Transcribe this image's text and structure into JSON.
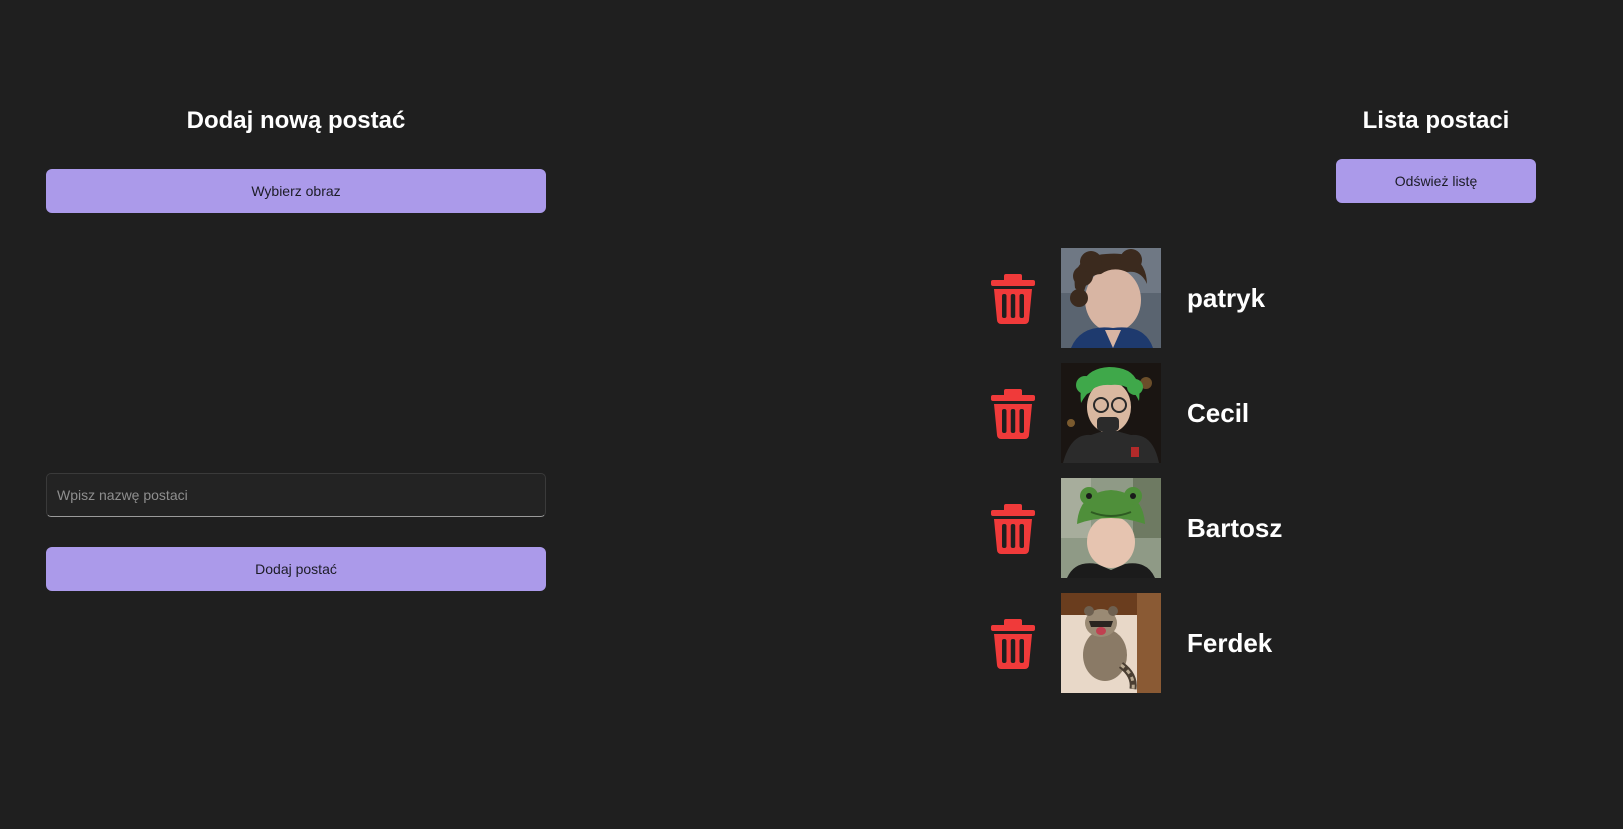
{
  "add_panel": {
    "title": "Dodaj nową postać",
    "choose_image_label": "Wybierz obraz",
    "name_input": {
      "value": "",
      "placeholder": "Wpisz nazwę postaci"
    },
    "add_button_label": "Dodaj postać"
  },
  "list_panel": {
    "title": "Lista postaci",
    "refresh_label": "Odśwież listę",
    "delete_icon": "trash-icon",
    "characters": [
      {
        "name": "patryk",
        "avatar": "photo-curly-hair-person"
      },
      {
        "name": "Cecil",
        "avatar": "photo-green-hair-person"
      },
      {
        "name": "Bartosz",
        "avatar": "photo-frog-hat-person"
      },
      {
        "name": "Ferdek",
        "avatar": "photo-raccoon"
      }
    ]
  },
  "colors": {
    "background": "#1f1f1f",
    "button": "#ab9aea",
    "button_text": "#1c1c26",
    "delete_icon": "#f03a3a",
    "text": "#ffffff"
  }
}
